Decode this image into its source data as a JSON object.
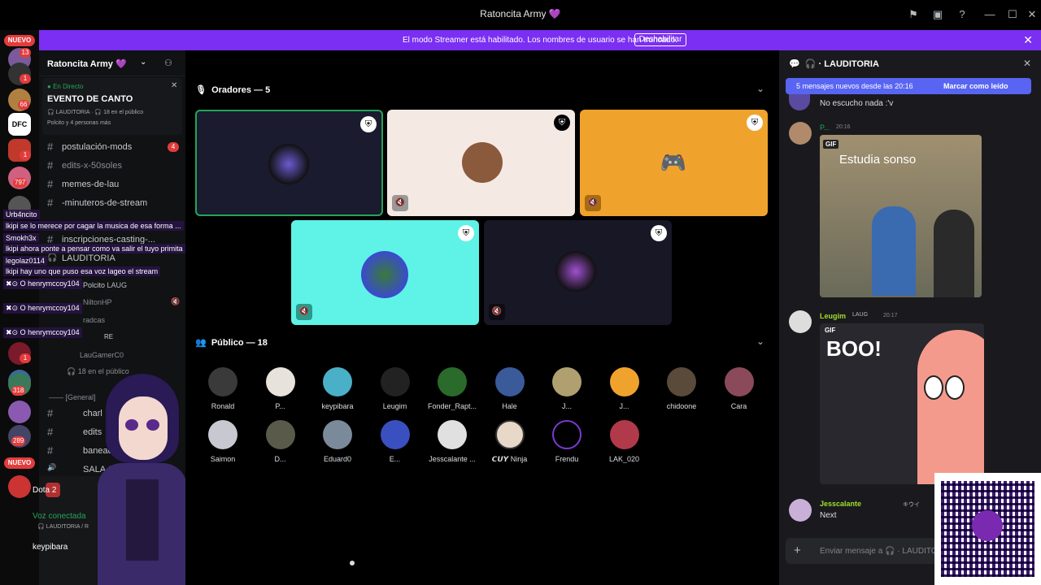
{
  "window": {
    "title": "Ratoncita Army 💜"
  },
  "banner": {
    "message": "El modo Streamer está habilitado. Los nombres de usuario se han truncado.",
    "button": "Deshabilitar"
  },
  "server_rail": {
    "new_label_top": "NUEVO",
    "new_label_bottom": "NUEVO",
    "badges": [
      "13",
      "1",
      "66",
      "1",
      "797",
      "1",
      "1",
      "318",
      "289",
      "1"
    ]
  },
  "sidebar": {
    "server_name": "Ratoncita Army 💜",
    "event": {
      "live": "En Directo",
      "title": "EVENTO DE CANTO",
      "channel": "LAUDITORIA",
      "audience": "18 en el público",
      "people": "Polcito y 4 personas más"
    },
    "channels": [
      {
        "name": "postulación-mods",
        "badge": "4"
      },
      {
        "name": "edits-x-50soles"
      },
      {
        "name": "memes-de-lau"
      },
      {
        "name": "-minuteros-de-stream"
      },
      {
        "name": "inscripciones-casting-..."
      },
      {
        "name": "LAUDITORIA"
      }
    ],
    "voice_members": [
      "Polcito",
      "NiltonHP",
      "radcas",
      "RE",
      "LauGamerC0"
    ],
    "voice_member_tag": "LAUG",
    "audience_line": "18 en el público",
    "category": "[General]",
    "more_channels": [
      "charl",
      "edits",
      "banead",
      "SALA 1 G"
    ],
    "dota": "Dota 2",
    "voice_connected": "Voz conectada",
    "voice_channel": "LAUDITORIA / R",
    "user": "keypibara"
  },
  "overlay_chat": [
    {
      "user": "Urb4ncito",
      "text": "lkipi se lo merece por cagar la musica de esa forma ..."
    },
    {
      "user": "Smokh3x",
      "text": "lkipi ahora ponte a pensar como va salir el tuyo primita"
    },
    {
      "user": "legolaz0114",
      "text": "lkipi hay uno que puso esa voz lageo el stream"
    },
    {
      "user": "henrymccoy104",
      "text": ""
    },
    {
      "user": "henrymccoy104",
      "text": ""
    },
    {
      "user": "henrymccoy104",
      "text": ""
    }
  ],
  "stage": {
    "speakers_label": "Oradores — 5",
    "audience_label": "Público — 18",
    "audience": [
      "Ronald",
      "P...",
      "keypibara",
      "Leugim",
      "Fonder_Rapt...",
      "Hale",
      "J...",
      "J...",
      "chidoone",
      "Cara",
      "Saimon",
      "D...",
      "Eduard0",
      "E...",
      "Jesscalante ...",
      "𝘾𝙐𝙔 Ninja",
      "Frendu",
      "LAK_020"
    ]
  },
  "chat": {
    "channel": "LAUDITORIA",
    "new_messages": "5 mensajes nuevos desde las 20:16",
    "mark_read": "Marcar como leído",
    "messages": [
      {
        "text": "No escucho nada :'v"
      },
      {
        "author": "P...",
        "time": "20:16",
        "gif_label": "GIF",
        "gif_caption": "Estudia sonso"
      },
      {
        "author": "Leugim",
        "tag": "LAUG",
        "time": "20:17",
        "gif_label": "GIF",
        "gif_caption": "BOO!"
      },
      {
        "author": "Jesscalante",
        "tag": "キウイ",
        "text": "Next"
      }
    ],
    "input_placeholder": "Enviar mensaje a",
    "input_channel": "LAUDITO"
  },
  "colors": {
    "banner": "#7b2ff2",
    "new_messages_bar": "#5865f2",
    "live_green": "#23a559",
    "gold_tile": "#f0a32c",
    "cyan_tile": "#5ff2e6",
    "discord_blurple": "#5865f2"
  }
}
